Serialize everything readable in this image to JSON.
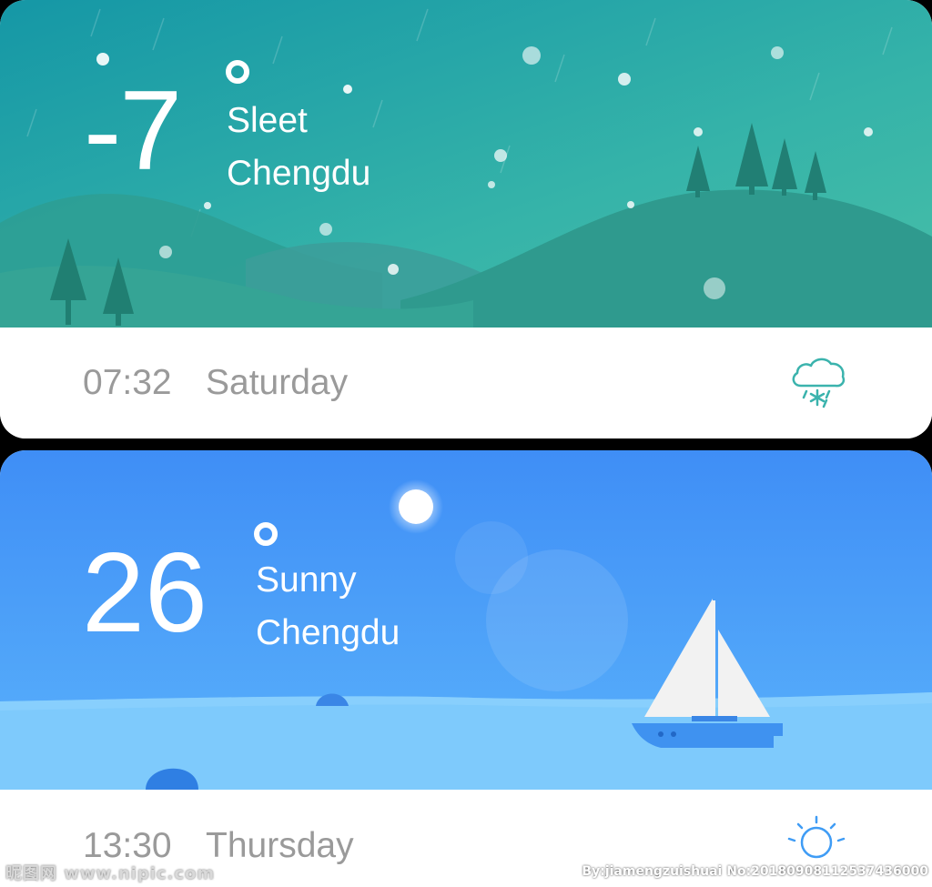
{
  "cards": [
    {
      "temperature": "-7",
      "condition": "Sleet",
      "city": "Chengdu",
      "time": "07:32",
      "day": "Saturday",
      "icon": "sleet-cloud-icon",
      "colors": {
        "sky_top": "#1a9ea4",
        "sky_bottom": "#3cb8a8",
        "hill": "#2f9a8e",
        "accent": "#3bb3ad"
      }
    },
    {
      "temperature": "26",
      "condition": "Sunny",
      "city": "Chengdu",
      "time": "13:30",
      "day": "Thursday",
      "icon": "sun-icon",
      "colors": {
        "sky_top": "#4a8ff5",
        "sky_bottom": "#62b8fb",
        "sea": "#7ecbfc",
        "accent": "#3f9cf5"
      }
    }
  ],
  "watermark": {
    "left": "昵图网 www.nipic.com",
    "right": "By:jiamengzuishuai No:20180908112537436000"
  }
}
